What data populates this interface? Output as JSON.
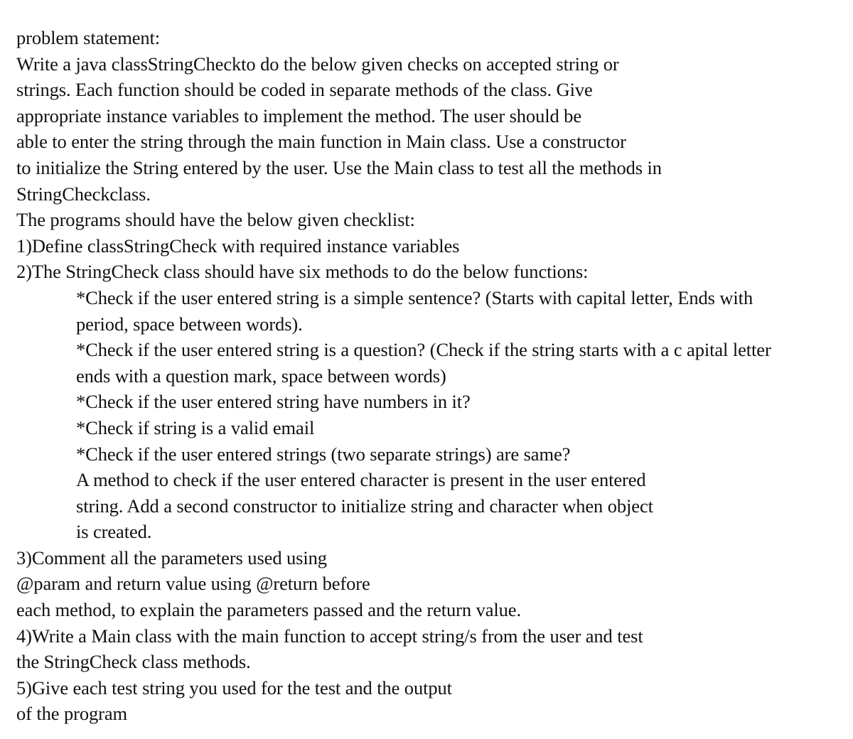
{
  "document": {
    "heading": "problem statement:",
    "intro_lines": [
      "Write a java classStringCheckto do the below given checks on accepted string or",
      "strings. Each function should be coded in separate methods of the class. Give",
      "appropriate instance variables to implement the method. The user should be",
      "able to enter the string through the main function in Main class. Use a constructor",
      "to initialize the String entered by the user. Use the Main class to test all the methods in",
      "StringCheckclass."
    ],
    "checklist_intro": "The programs should have the below given checklist:",
    "item1": "1)Define classStringCheck with required instance variables",
    "item2": "2)The StringCheck class should have six methods to do the below functions:",
    "item2_sub_lines": [
      "*Check if the user entered string is a simple sentence? (Starts with capital letter, Ends with",
      "period, space between words).",
      "*Check if the user entered string is a question? (Check if the string starts with a c apital letter",
      "ends with a question mark, space between words)",
      "*Check if the user entered string have numbers in it?",
      "*Check if string is a valid email",
      "*Check if the user entered strings (two separate strings) are same?",
      "A method to check if the user entered character is present in the user entered",
      "string. Add a second constructor to initialize string and character when object",
      "is created."
    ],
    "item3_lines": [
      "3)Comment all the parameters used using",
      "@param and return value using @return before",
      "each method, to explain the parameters passed and the return value."
    ],
    "item4_lines": [
      "4)Write a Main class with the main function to accept string/s from the user and test",
      "the StringCheck class methods."
    ],
    "item5_lines": [
      "5)Give each test string you used for the test and the output",
      "of the program"
    ]
  }
}
